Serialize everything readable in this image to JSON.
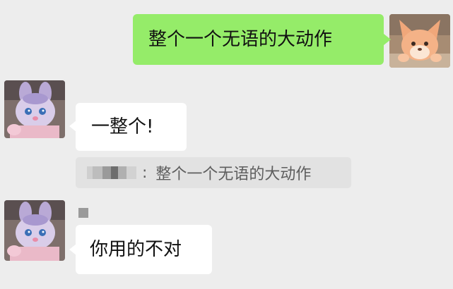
{
  "chat": {
    "messages": [
      {
        "id": "m1",
        "side": "outgoing",
        "text": "整个一个无语的大动作"
      },
      {
        "id": "m2",
        "side": "incoming",
        "text": "一整个!",
        "quote": {
          "sender": "",
          "text": "整个一个无语的大动作"
        }
      },
      {
        "id": "m3",
        "side": "incoming",
        "text": "你用的不对"
      }
    ]
  },
  "quote_separator": ":",
  "colors": {
    "background": "#ededed",
    "outgoing_bubble": "#95ec69",
    "incoming_bubble": "#ffffff",
    "quote_box": "#e2e2e2"
  },
  "avatars": {
    "self": "plush-fox-avatar",
    "other": "plush-bunny-avatar"
  }
}
